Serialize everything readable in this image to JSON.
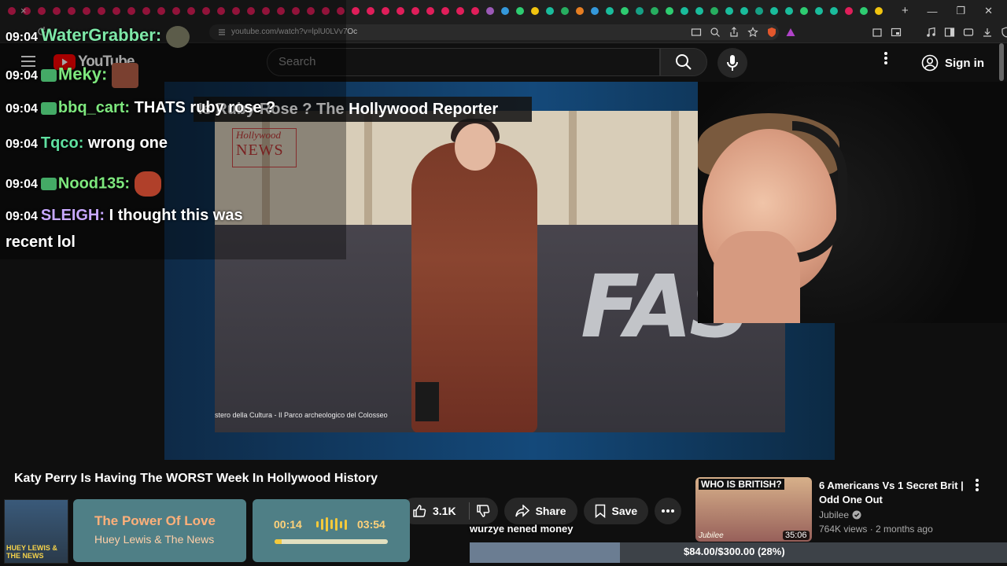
{
  "browser": {
    "url": "youtube.com/watch?v=lplU0LVv7Oc",
    "tab_close": "×",
    "new_tab": "+",
    "win_min": "—",
    "win_max": "❐",
    "win_close": "✕",
    "tab_colors": [
      "#e01e5a",
      "#e01e5a",
      "#e01e5a",
      "#e01e5a",
      "#e01e5a",
      "#e01e5a",
      "#e01e5a",
      "#e01e5a",
      "#e01e5a",
      "#e01e5a",
      "#e01e5a",
      "#e01e5a",
      "#e01e5a",
      "#e01e5a",
      "#e01e5a",
      "#e01e5a",
      "#e01e5a",
      "#e01e5a",
      "#e01e5a",
      "#e01e5a",
      "#e01e5a",
      "#e01e5a",
      "#e01e5a",
      "#e01e5a",
      "#e01e5a",
      "#e01e5a",
      "#e01e5a",
      "#e01e5a",
      "#e01e5a",
      "#e01e5a",
      "#e01e5a",
      "#e01e5a",
      "#9b59b6",
      "#3498db",
      "#2ecc71",
      "#f1c40f",
      "#1abc9c",
      "#27ae60",
      "#e67e22",
      "#3498db",
      "#1abc9c",
      "#2ecc71",
      "#16a085",
      "#27ae60",
      "#2ecc71",
      "#1abc9c",
      "#1abc9c",
      "#27ae60",
      "#1abc9c",
      "#1abc9c",
      "#16a085",
      "#1abc9c",
      "#1abc9c",
      "#2ecc71",
      "#1abc9c",
      "#1abc9c",
      "#e01e5a",
      "#2ecc71",
      "#f1c40f"
    ]
  },
  "header": {
    "logo_text": "YouTube",
    "search_placeholder": "Search",
    "sign_in": "Sign in"
  },
  "video": {
    "headline": "Is Ruby Rose ? The Hollywood Reporter",
    "logo_line1": "Hollywood",
    "logo_line2": "NEWS",
    "caption": "stero della Cultura - Il Parco archeologico del Colosseo",
    "brand_letters": "FAS",
    "title": "Katy Perry Is Having The WORST Week In Hollywood History",
    "likes": "3.1K",
    "share": "Share",
    "save": "Save",
    "subtitle": "wurzye nened money"
  },
  "chat": [
    {
      "time": "09:04",
      "user": "WaterGrabber",
      "color": "#7ee8a8",
      "msg": ""
    },
    {
      "time": "09:04",
      "user": "Meky",
      "color": "#7ee87e",
      "msg": ""
    },
    {
      "time": "09:04",
      "user": "bbq_cart",
      "color": "#7ee87e",
      "msg": "THATS ruby rose ?"
    },
    {
      "time": "09:04",
      "user": "Tqco",
      "color": "#5fe0a0",
      "msg": "wrong one"
    },
    {
      "time": "09:04",
      "user": "Nood135",
      "color": "#7ee87e",
      "msg": ""
    },
    {
      "time": "09:04",
      "user": "SLEIGH",
      "color": "#c8a8ff",
      "msg": "I thought this was",
      "msg2": "recent lol"
    }
  ],
  "now_playing": {
    "art_text": "HUEY LEWIS & THE NEWS",
    "title": "The Power Of Love",
    "artist": "Huey Lewis & The News",
    "elapsed": "00:14",
    "total": "03:54",
    "progress": 0.06
  },
  "donation": {
    "text": "$84.00/$300.00 (28%)",
    "progress": 0.28
  },
  "suggested": {
    "thumb_title": "WHO IS BRITISH?",
    "thumb_brand": "Jubilee",
    "duration": "35:06",
    "title": "6 Americans Vs 1 Secret Brit | Odd One Out",
    "channel": "Jubilee",
    "views": "764K views",
    "age": "2 months ago"
  }
}
